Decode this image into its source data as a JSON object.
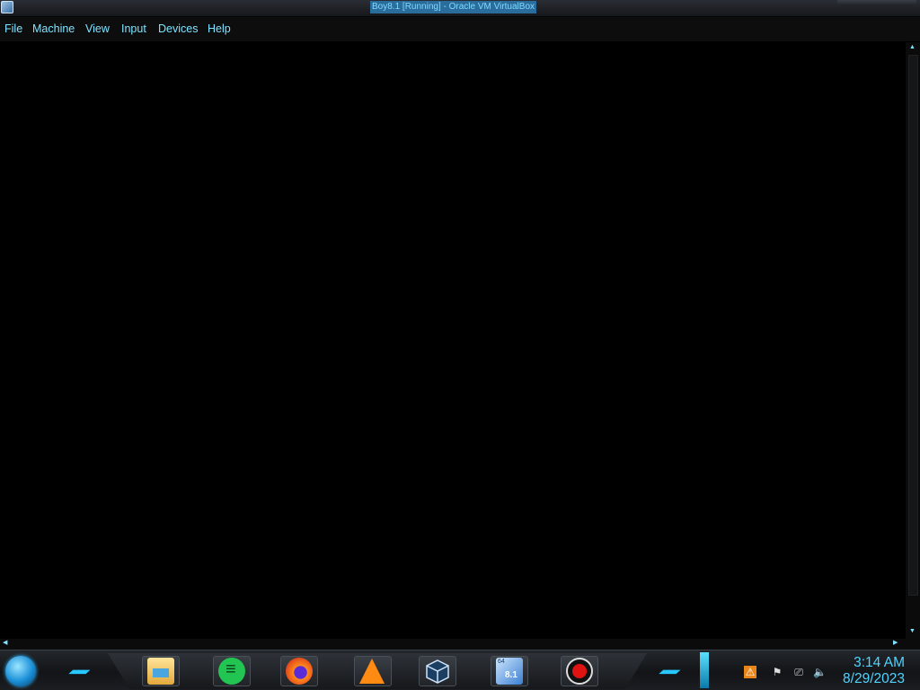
{
  "window": {
    "title": "Boy8.1 [Running] - Oracle VM VirtualBox"
  },
  "menu": {
    "items": [
      "File",
      "Machine",
      "View",
      "Input",
      "Devices",
      "Help"
    ]
  },
  "taskbar": {
    "pinned_apps": [
      {
        "name": "file-explorer-icon"
      },
      {
        "name": "chat-app-icon"
      },
      {
        "name": "firefox-icon"
      },
      {
        "name": "vlc-icon"
      },
      {
        "name": "virtualbox-icon"
      },
      {
        "name": "windows-8-1-vm-icon",
        "label": "8.1",
        "badge": "64"
      },
      {
        "name": "screen-recorder-icon"
      }
    ],
    "tray": {
      "icons": [
        "java-update-icon",
        "action-center-flag-icon",
        "network-icon",
        "volume-icon"
      ]
    },
    "clock": {
      "time": "3:14 AM",
      "date": "8/29/2023"
    }
  },
  "colors": {
    "accent": "#27c8ff",
    "menu_text": "#7fe3ff",
    "clock_text": "#4fd3ff",
    "vm_screen": "#000000"
  }
}
